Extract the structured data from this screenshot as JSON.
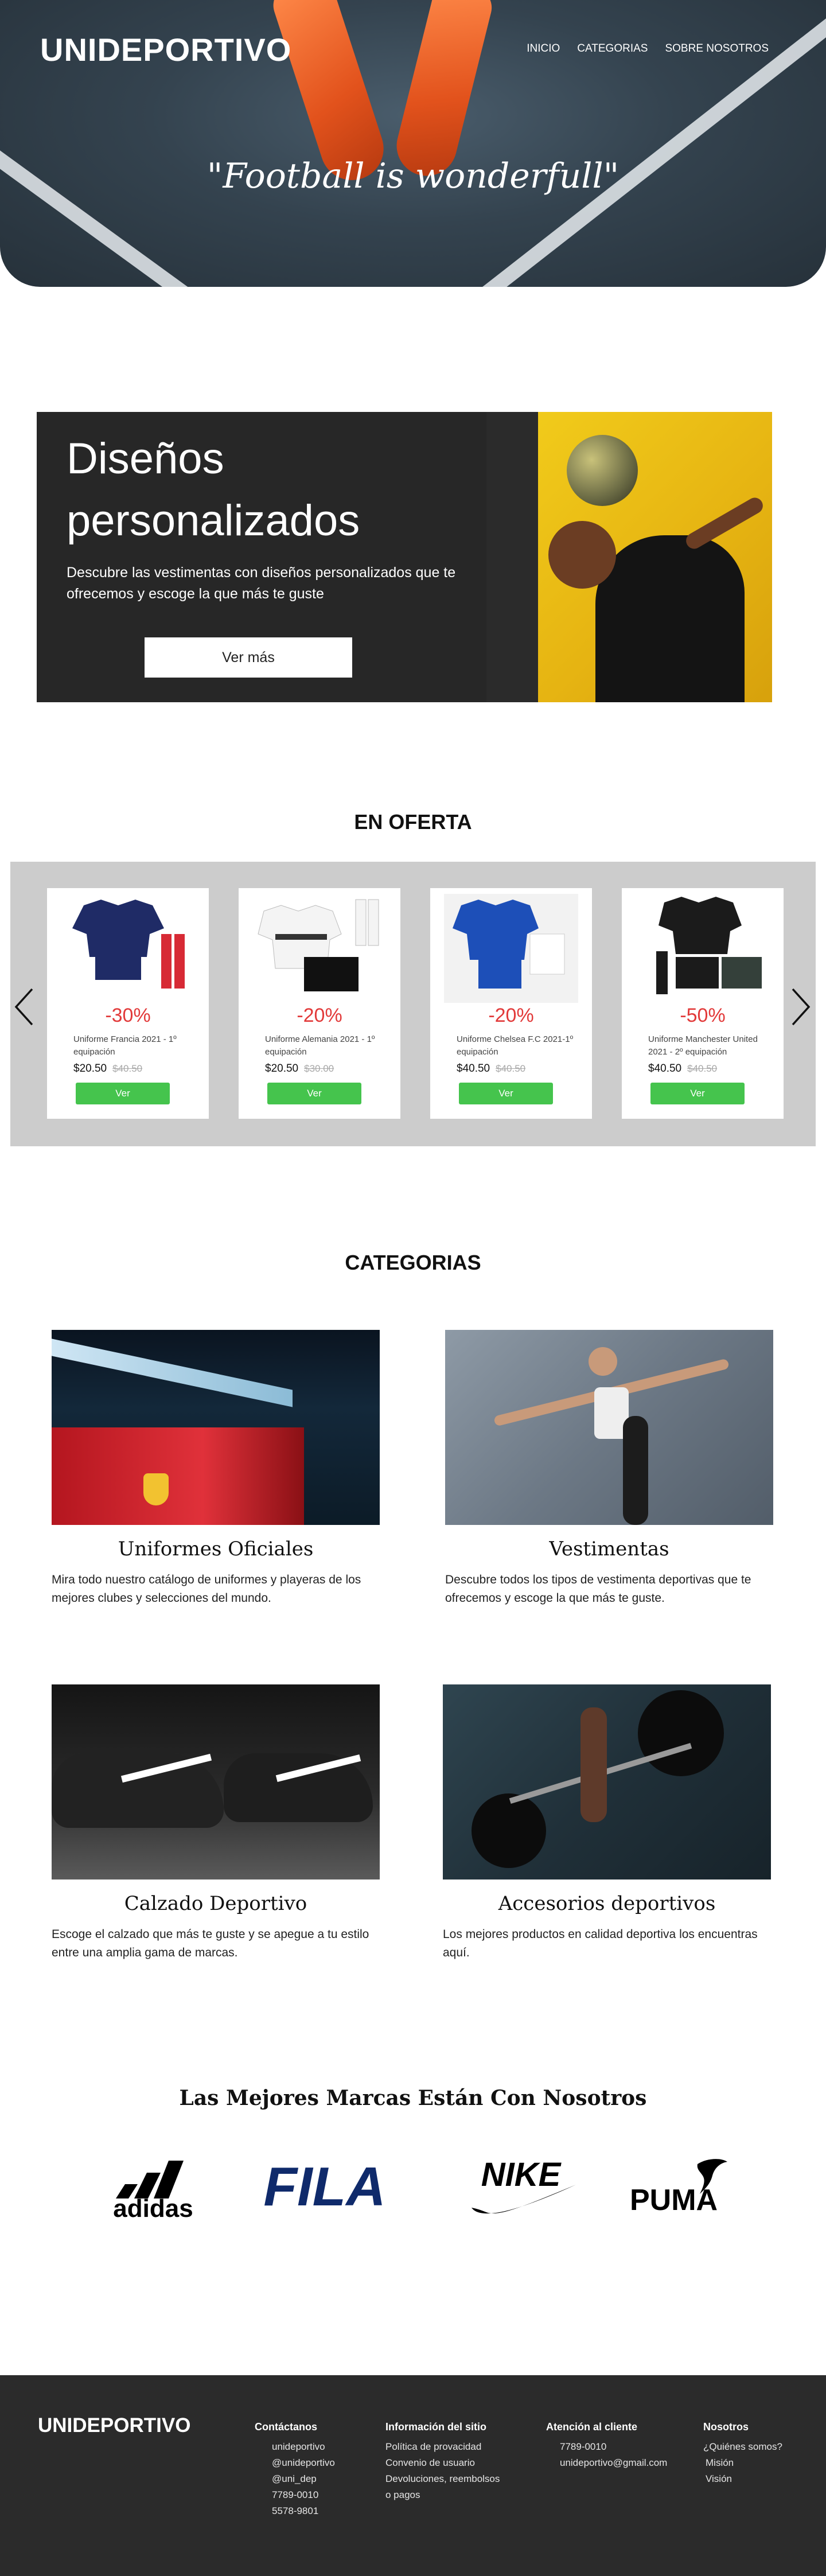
{
  "header": {
    "brand": "UNIDEPORTIVO",
    "nav": [
      "INICIO",
      "CATEGORIAS",
      "SOBRE NOSOTROS"
    ],
    "tagline": "\"Football is wonderfull\""
  },
  "custom": {
    "title_line1": "Diseños",
    "title_line2": "personalizados",
    "description": "Descubre las vestimentas con diseños personalizados que te ofrecemos y escoge la que más te guste",
    "button": "Ver más"
  },
  "offers": {
    "title": "EN OFERTA",
    "items": [
      {
        "discount": "-30%",
        "name": "Uniforme Francia 2021 - 1º equipación",
        "price": "$20.50",
        "old_price": "$40.50",
        "button": "Ver"
      },
      {
        "discount": "-20%",
        "name": "Uniforme Alemania 2021 - 1º equipación",
        "price": "$20.50",
        "old_price": "$30.00",
        "button": "Ver"
      },
      {
        "discount": "-20%",
        "name": "Uniforme Chelsea F.C 2021-1º equipación",
        "price": "$40.50",
        "old_price": "$40.50",
        "button": "Ver"
      },
      {
        "discount": "-50%",
        "name": "Uniforme Manchester United 2021 - 2º equipación",
        "price": "$40.50",
        "old_price": "$40.50",
        "button": "Ver"
      }
    ]
  },
  "categories": {
    "title": "CATEGORIAS",
    "items": [
      {
        "name": "Uniformes Oficiales",
        "description": "Mira todo nuestro catálogo de uniformes y playeras de los mejores clubes y selecciones del mundo."
      },
      {
        "name": "Vestimentas",
        "description": "Descubre todos los tipos de vestimenta  deportivas que te ofrecemos y escoge la que más te guste."
      },
      {
        "name": "Calzado Deportivo",
        "description": "Escoge el calzado que más te guste y se apegue a tu estilo entre una amplia gama de marcas."
      },
      {
        "name": "Accesorios deportivos",
        "description": "Los mejores productos en calidad deportiva los encuentras aquí."
      }
    ]
  },
  "brands": {
    "title": "Las Mejores Marcas Están Con Nosotros",
    "items": [
      "adidas",
      "FILA",
      "NIKE",
      "PUMA"
    ]
  },
  "footer": {
    "brand": "UNIDEPORTIVO",
    "contact": {
      "title": "Contáctanos",
      "items": [
        "unideportivo",
        "@unideportivo",
        "@uni_dep",
        "7789-0010",
        "5578-9801"
      ]
    },
    "site": {
      "title": "Información del sitio",
      "items": [
        "Política de provacidad",
        "Convenio de usuario",
        "Devoluciones, reembolsos",
        "o pagos"
      ]
    },
    "support": {
      "title": "Atención al cliente",
      "items": [
        "7789-0010",
        "unideportivo@gmail.com"
      ]
    },
    "about": {
      "title": "Nosotros",
      "items": [
        "¿Quiénes somos?",
        "Misión",
        "Visión"
      ]
    }
  },
  "colors": {
    "accent_green": "#45c44d",
    "discount_red": "#e23a3a",
    "dark_panel": "#272727",
    "footer_bg": "#2b2b2b",
    "offer_band": "#cccccc"
  }
}
